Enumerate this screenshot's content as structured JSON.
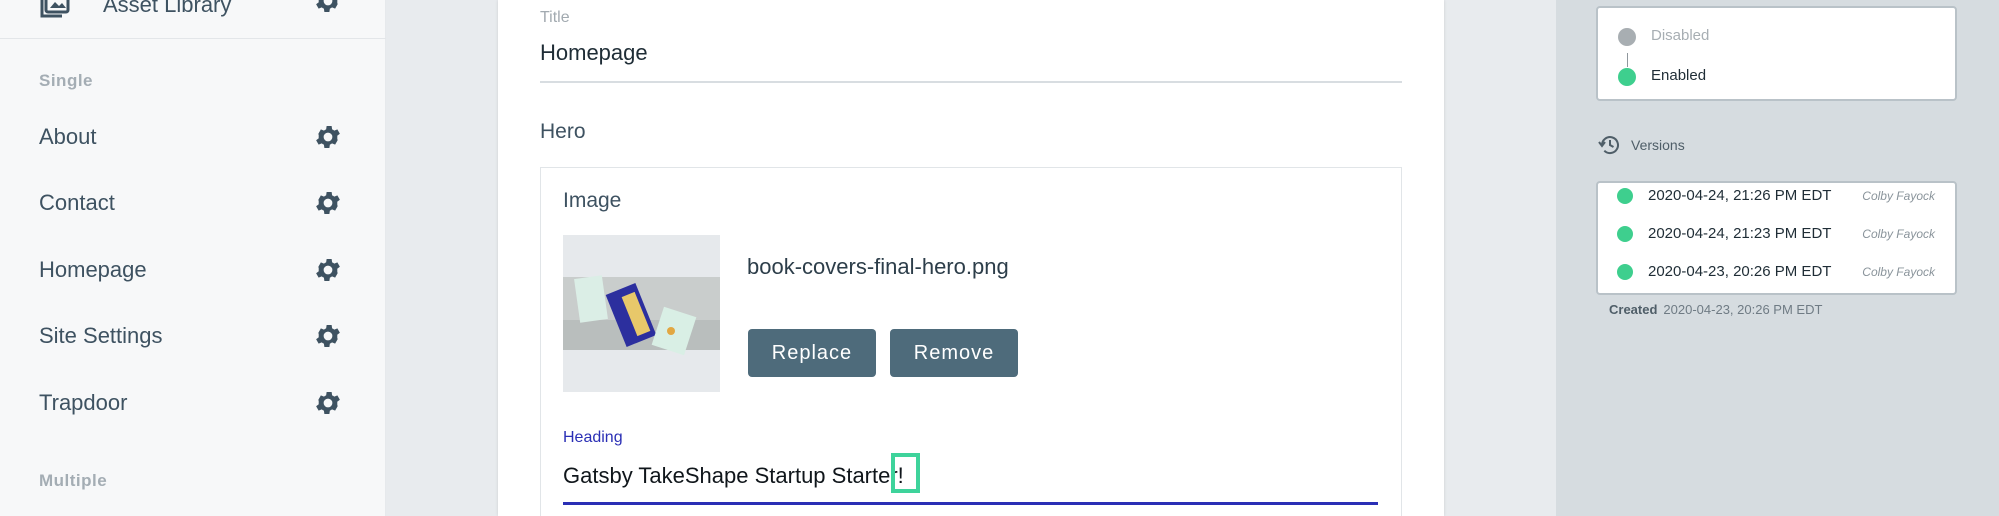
{
  "sidebar": {
    "top_item": {
      "label": "Asset Library",
      "icon": "image-library-icon"
    },
    "sections": [
      {
        "title": "Single",
        "items": [
          {
            "label": "About"
          },
          {
            "label": "Contact"
          },
          {
            "label": "Homepage"
          },
          {
            "label": "Site Settings"
          },
          {
            "label": "Trapdoor"
          }
        ]
      },
      {
        "title": "Multiple",
        "items": []
      }
    ]
  },
  "editor": {
    "title_field": {
      "label": "Title",
      "value": "Homepage"
    },
    "hero": {
      "label": "Hero",
      "image": {
        "label": "Image",
        "filename": "book-covers-final-hero.png",
        "replace_label": "Replace",
        "remove_label": "Remove"
      },
      "heading": {
        "label": "Heading",
        "value": "Gatsby TakeShape Startup Starter!"
      }
    }
  },
  "status": {
    "options": [
      {
        "label": "Disabled",
        "color": "#a8aeb2",
        "active": false
      },
      {
        "label": "Enabled",
        "color": "#3ecf8e",
        "active": true
      }
    ]
  },
  "versions": {
    "label": "Versions",
    "items": [
      {
        "date": "2020-04-24, 21:26 PM EDT",
        "author": "Colby Fayock"
      },
      {
        "date": "2020-04-24, 21:23 PM EDT",
        "author": "Colby Fayock"
      },
      {
        "date": "2020-04-23, 20:26 PM EDT",
        "author": "Colby Fayock"
      }
    ],
    "created_label": "Created",
    "created_value": "2020-04-23, 20:26 PM EDT"
  },
  "colors": {
    "accent": "#2a2fb5",
    "button": "#4e6b7b",
    "success": "#3ecf8e",
    "focus_highlight": "#3ed39b"
  }
}
